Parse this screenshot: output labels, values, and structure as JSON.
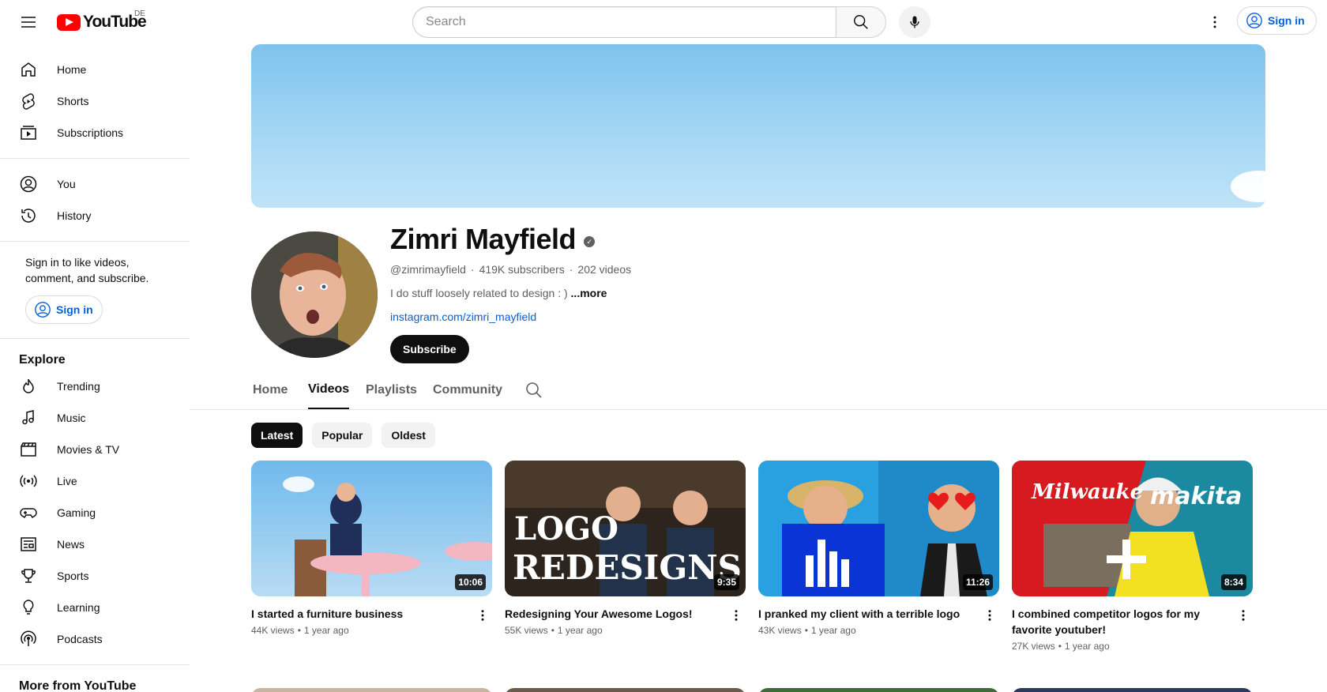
{
  "header": {
    "logo_text": "YouTube",
    "country_code": "DE",
    "search_placeholder": "Search",
    "signin_label": "Sign in"
  },
  "sidebar": {
    "main": [
      {
        "label": "Home",
        "icon": "home-icon"
      },
      {
        "label": "Shorts",
        "icon": "shorts-icon"
      },
      {
        "label": "Subscriptions",
        "icon": "subscriptions-icon"
      }
    ],
    "you": [
      {
        "label": "You",
        "icon": "user-icon"
      },
      {
        "label": "History",
        "icon": "history-icon"
      }
    ],
    "signin_prompt": "Sign in to like videos, comment, and subscribe.",
    "signin_label": "Sign in",
    "explore_title": "Explore",
    "explore": [
      {
        "label": "Trending",
        "icon": "trending-icon"
      },
      {
        "label": "Music",
        "icon": "music-icon"
      },
      {
        "label": "Movies & TV",
        "icon": "movies-icon"
      },
      {
        "label": "Live",
        "icon": "live-icon"
      },
      {
        "label": "Gaming",
        "icon": "gaming-icon"
      },
      {
        "label": "News",
        "icon": "news-icon"
      },
      {
        "label": "Sports",
        "icon": "sports-icon"
      },
      {
        "label": "Learning",
        "icon": "learning-icon"
      },
      {
        "label": "Podcasts",
        "icon": "podcasts-icon"
      }
    ],
    "more_title": "More from YouTube"
  },
  "channel": {
    "name": "Zimri Mayfield",
    "handle": "@zimrimayfield",
    "subscribers": "419K subscribers",
    "videos_count": "202 videos",
    "description": "I do stuff loosely related to design : )",
    "more_label": "...more",
    "link": "instagram.com/zimri_mayfield",
    "subscribe_label": "Subscribe"
  },
  "tabs": [
    {
      "label": "Home",
      "active": false
    },
    {
      "label": "Videos",
      "active": true
    },
    {
      "label": "Playlists",
      "active": false
    },
    {
      "label": "Community",
      "active": false
    }
  ],
  "chips": [
    {
      "label": "Latest",
      "active": true
    },
    {
      "label": "Popular",
      "active": false
    },
    {
      "label": "Oldest",
      "active": false
    }
  ],
  "videos": [
    {
      "title": "I started a furniture business",
      "views": "44K views",
      "age": "1 year ago",
      "duration": "10:06"
    },
    {
      "title": "Redesigning Your Awesome Logos!",
      "views": "55K views",
      "age": "1 year ago",
      "duration": "9:35",
      "thumb_text": [
        "LOGO",
        "REDESIGNS"
      ]
    },
    {
      "title": "I pranked my client with a terrible logo",
      "views": "43K views",
      "age": "1 year ago",
      "duration": "11:26"
    },
    {
      "title": "I combined competitor logos for my favorite youtuber!",
      "views": "27K views",
      "age": "1 year ago",
      "duration": "8:34",
      "thumb_text": [
        "Milwauke",
        "makita"
      ]
    }
  ],
  "colors": {
    "accent_blue": "#065fd4",
    "brand_red": "#ff0000",
    "text_primary": "#0f0f0f",
    "text_secondary": "#606060"
  }
}
